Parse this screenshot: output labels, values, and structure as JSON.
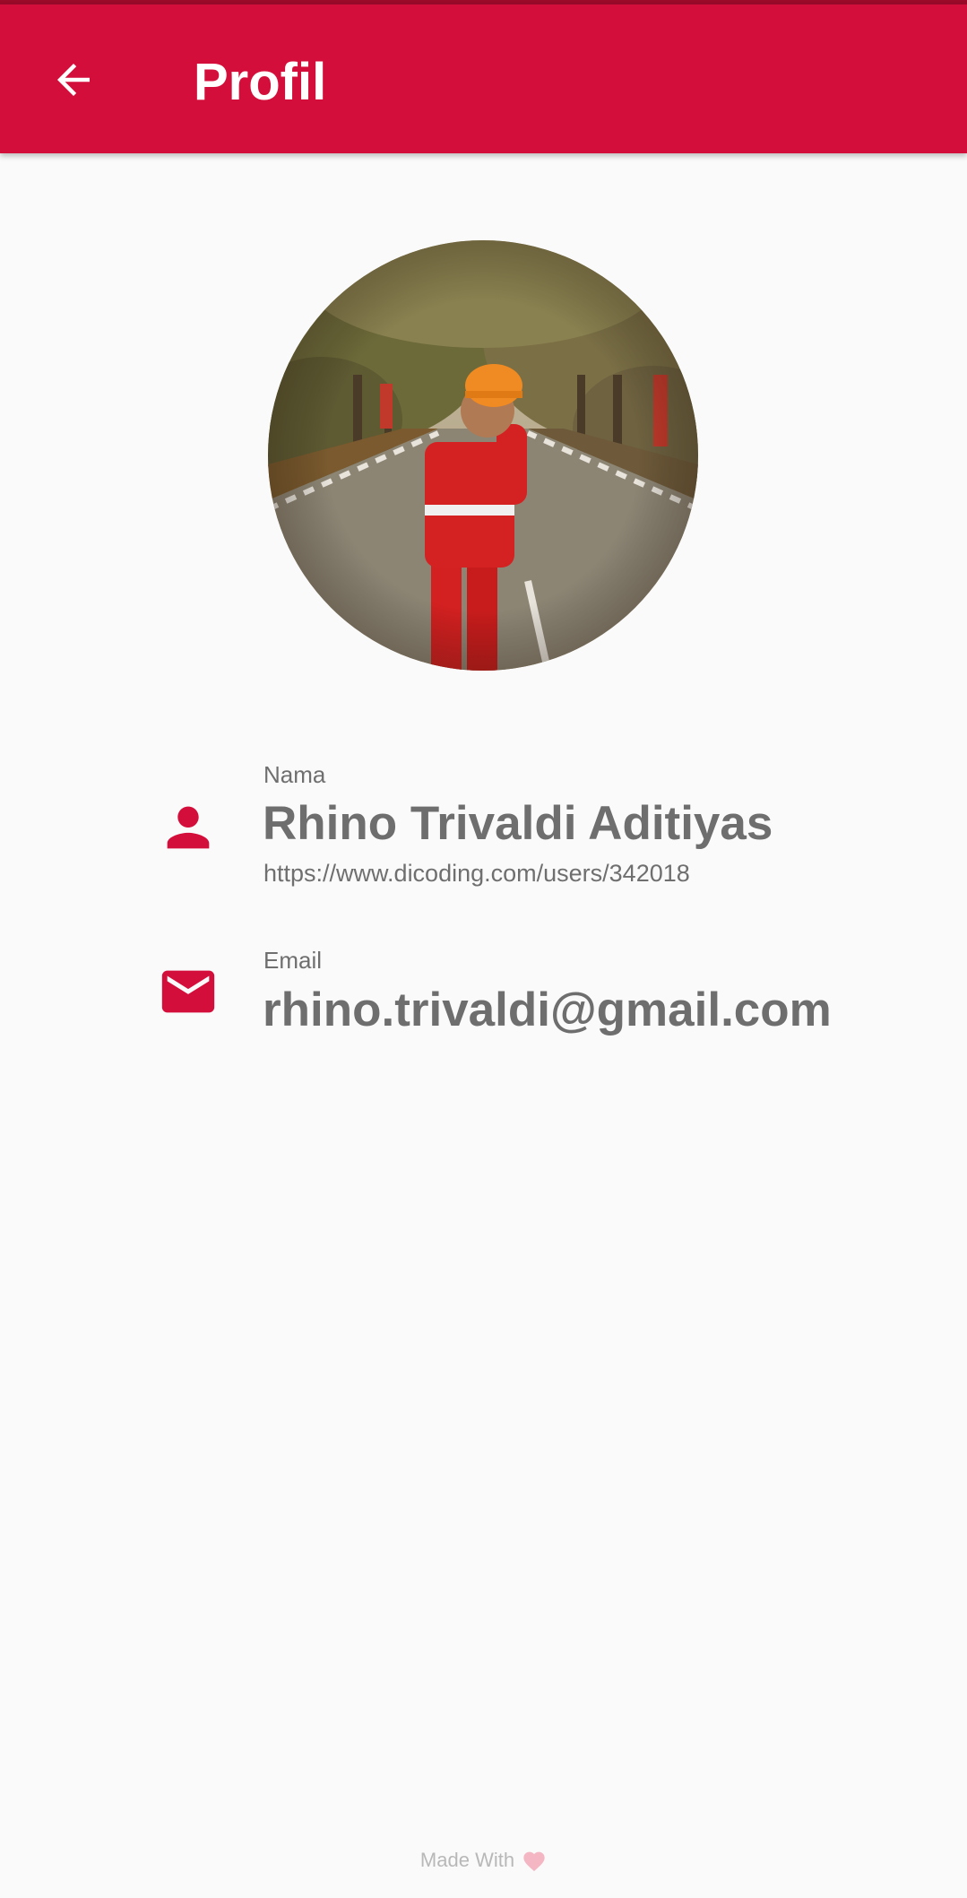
{
  "appbar": {
    "title": "Profil",
    "back_icon": "arrow-left-icon",
    "color": "#d40e3a"
  },
  "profile": {
    "name_label": "Nama",
    "name": "Rhino Trivaldi Aditiyas",
    "url": "https://www.dicoding.com/users/342018",
    "email_label": "Email",
    "email": "rhino.trivaldi@gmail.com",
    "name_icon": "person-icon",
    "email_icon": "mail-icon"
  },
  "footer": {
    "text": "Made With",
    "icon": "heart-icon"
  }
}
